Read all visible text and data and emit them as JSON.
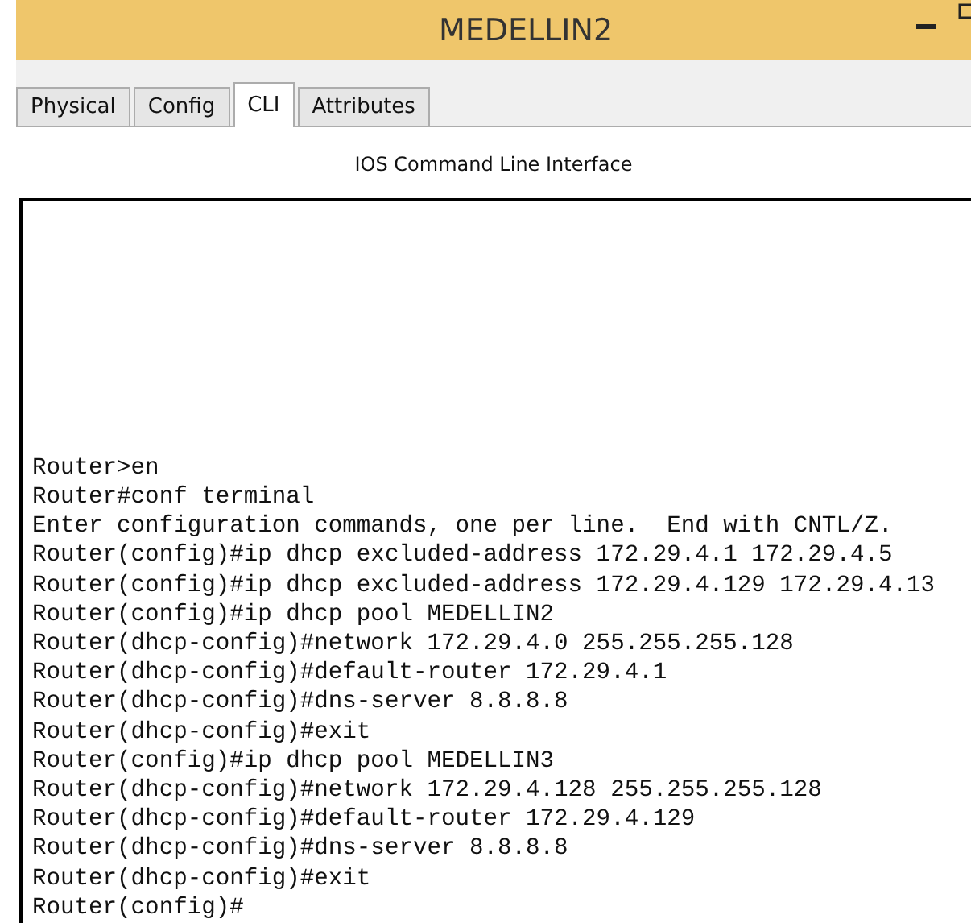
{
  "window": {
    "title": "MEDELLIN2"
  },
  "tabs": [
    {
      "label": "Physical",
      "selected": false
    },
    {
      "label": "Config",
      "selected": false
    },
    {
      "label": "CLI",
      "selected": true
    },
    {
      "label": "Attributes",
      "selected": false
    }
  ],
  "panel_title": "IOS Command Line Interface",
  "terminal": {
    "lines": [
      "Router>en",
      "Router#conf terminal",
      "Enter configuration commands, one per line.  End with CNTL/Z.",
      "Router(config)#ip dhcp excluded-address 172.29.4.1 172.29.4.5",
      "Router(config)#ip dhcp excluded-address 172.29.4.129 172.29.4.13",
      "Router(config)#ip dhcp pool MEDELLIN2",
      "Router(dhcp-config)#network 172.29.4.0 255.255.255.128",
      "Router(dhcp-config)#default-router 172.29.4.1",
      "Router(dhcp-config)#dns-server 8.8.8.8",
      "Router(dhcp-config)#exit",
      "Router(config)#ip dhcp pool MEDELLIN3",
      "Router(dhcp-config)#network 172.29.4.128 255.255.255.128",
      "Router(dhcp-config)#default-router 172.29.4.129",
      "Router(dhcp-config)#dns-server 8.8.8.8",
      "Router(dhcp-config)#exit",
      "Router(config)#"
    ]
  }
}
